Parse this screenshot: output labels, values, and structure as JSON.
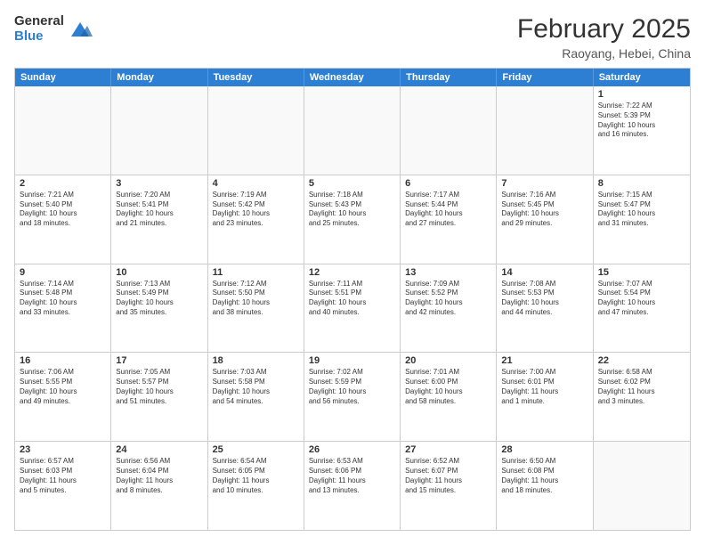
{
  "header": {
    "logo_general": "General",
    "logo_blue": "Blue",
    "month_year": "February 2025",
    "location": "Raoyang, Hebei, China"
  },
  "days": [
    "Sunday",
    "Monday",
    "Tuesday",
    "Wednesday",
    "Thursday",
    "Friday",
    "Saturday"
  ],
  "rows": [
    [
      {
        "num": "",
        "text": "",
        "empty": true
      },
      {
        "num": "",
        "text": "",
        "empty": true
      },
      {
        "num": "",
        "text": "",
        "empty": true
      },
      {
        "num": "",
        "text": "",
        "empty": true
      },
      {
        "num": "",
        "text": "",
        "empty": true
      },
      {
        "num": "",
        "text": "",
        "empty": true
      },
      {
        "num": "1",
        "text": "Sunrise: 7:22 AM\nSunset: 5:39 PM\nDaylight: 10 hours\nand 16 minutes.",
        "empty": false
      }
    ],
    [
      {
        "num": "2",
        "text": "Sunrise: 7:21 AM\nSunset: 5:40 PM\nDaylight: 10 hours\nand 18 minutes.",
        "empty": false
      },
      {
        "num": "3",
        "text": "Sunrise: 7:20 AM\nSunset: 5:41 PM\nDaylight: 10 hours\nand 21 minutes.",
        "empty": false
      },
      {
        "num": "4",
        "text": "Sunrise: 7:19 AM\nSunset: 5:42 PM\nDaylight: 10 hours\nand 23 minutes.",
        "empty": false
      },
      {
        "num": "5",
        "text": "Sunrise: 7:18 AM\nSunset: 5:43 PM\nDaylight: 10 hours\nand 25 minutes.",
        "empty": false
      },
      {
        "num": "6",
        "text": "Sunrise: 7:17 AM\nSunset: 5:44 PM\nDaylight: 10 hours\nand 27 minutes.",
        "empty": false
      },
      {
        "num": "7",
        "text": "Sunrise: 7:16 AM\nSunset: 5:45 PM\nDaylight: 10 hours\nand 29 minutes.",
        "empty": false
      },
      {
        "num": "8",
        "text": "Sunrise: 7:15 AM\nSunset: 5:47 PM\nDaylight: 10 hours\nand 31 minutes.",
        "empty": false
      }
    ],
    [
      {
        "num": "9",
        "text": "Sunrise: 7:14 AM\nSunset: 5:48 PM\nDaylight: 10 hours\nand 33 minutes.",
        "empty": false
      },
      {
        "num": "10",
        "text": "Sunrise: 7:13 AM\nSunset: 5:49 PM\nDaylight: 10 hours\nand 35 minutes.",
        "empty": false
      },
      {
        "num": "11",
        "text": "Sunrise: 7:12 AM\nSunset: 5:50 PM\nDaylight: 10 hours\nand 38 minutes.",
        "empty": false
      },
      {
        "num": "12",
        "text": "Sunrise: 7:11 AM\nSunset: 5:51 PM\nDaylight: 10 hours\nand 40 minutes.",
        "empty": false
      },
      {
        "num": "13",
        "text": "Sunrise: 7:09 AM\nSunset: 5:52 PM\nDaylight: 10 hours\nand 42 minutes.",
        "empty": false
      },
      {
        "num": "14",
        "text": "Sunrise: 7:08 AM\nSunset: 5:53 PM\nDaylight: 10 hours\nand 44 minutes.",
        "empty": false
      },
      {
        "num": "15",
        "text": "Sunrise: 7:07 AM\nSunset: 5:54 PM\nDaylight: 10 hours\nand 47 minutes.",
        "empty": false
      }
    ],
    [
      {
        "num": "16",
        "text": "Sunrise: 7:06 AM\nSunset: 5:55 PM\nDaylight: 10 hours\nand 49 minutes.",
        "empty": false
      },
      {
        "num": "17",
        "text": "Sunrise: 7:05 AM\nSunset: 5:57 PM\nDaylight: 10 hours\nand 51 minutes.",
        "empty": false
      },
      {
        "num": "18",
        "text": "Sunrise: 7:03 AM\nSunset: 5:58 PM\nDaylight: 10 hours\nand 54 minutes.",
        "empty": false
      },
      {
        "num": "19",
        "text": "Sunrise: 7:02 AM\nSunset: 5:59 PM\nDaylight: 10 hours\nand 56 minutes.",
        "empty": false
      },
      {
        "num": "20",
        "text": "Sunrise: 7:01 AM\nSunset: 6:00 PM\nDaylight: 10 hours\nand 58 minutes.",
        "empty": false
      },
      {
        "num": "21",
        "text": "Sunrise: 7:00 AM\nSunset: 6:01 PM\nDaylight: 11 hours\nand 1 minute.",
        "empty": false
      },
      {
        "num": "22",
        "text": "Sunrise: 6:58 AM\nSunset: 6:02 PM\nDaylight: 11 hours\nand 3 minutes.",
        "empty": false
      }
    ],
    [
      {
        "num": "23",
        "text": "Sunrise: 6:57 AM\nSunset: 6:03 PM\nDaylight: 11 hours\nand 5 minutes.",
        "empty": false
      },
      {
        "num": "24",
        "text": "Sunrise: 6:56 AM\nSunset: 6:04 PM\nDaylight: 11 hours\nand 8 minutes.",
        "empty": false
      },
      {
        "num": "25",
        "text": "Sunrise: 6:54 AM\nSunset: 6:05 PM\nDaylight: 11 hours\nand 10 minutes.",
        "empty": false
      },
      {
        "num": "26",
        "text": "Sunrise: 6:53 AM\nSunset: 6:06 PM\nDaylight: 11 hours\nand 13 minutes.",
        "empty": false
      },
      {
        "num": "27",
        "text": "Sunrise: 6:52 AM\nSunset: 6:07 PM\nDaylight: 11 hours\nand 15 minutes.",
        "empty": false
      },
      {
        "num": "28",
        "text": "Sunrise: 6:50 AM\nSunset: 6:08 PM\nDaylight: 11 hours\nand 18 minutes.",
        "empty": false
      },
      {
        "num": "",
        "text": "",
        "empty": true
      }
    ]
  ]
}
